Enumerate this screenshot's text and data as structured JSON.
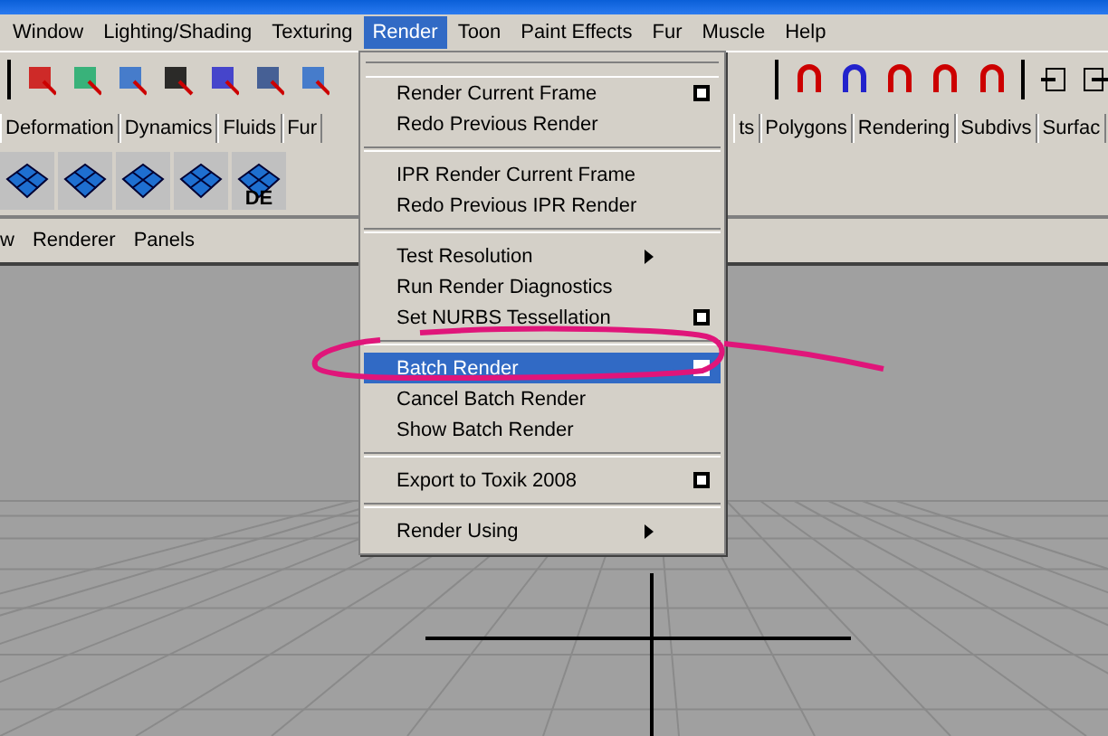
{
  "menubar": [
    {
      "label": "Window",
      "selected": false
    },
    {
      "label": "Lighting/Shading",
      "selected": false
    },
    {
      "label": "Texturing",
      "selected": false
    },
    {
      "label": "Render",
      "selected": true
    },
    {
      "label": "Toon",
      "selected": false
    },
    {
      "label": "Paint Effects",
      "selected": false
    },
    {
      "label": "Fur",
      "selected": false
    },
    {
      "label": "Muscle",
      "selected": false
    },
    {
      "label": "Help",
      "selected": false
    }
  ],
  "shelf_tabs_left": [
    "Deformation",
    "Dynamics",
    "Fluids",
    "Fur"
  ],
  "shelf_tabs_right": [
    "ts",
    "Polygons",
    "Rendering",
    "Subdivs",
    "Surfac"
  ],
  "shelf_icon_label": "DE",
  "panel_menu": [
    "w",
    "Renderer",
    "Panels"
  ],
  "render_menu": [
    {
      "kind": "tearoff"
    },
    {
      "kind": "item",
      "label": "Render Current Frame",
      "option_box": true,
      "submenu": false,
      "selected": false
    },
    {
      "kind": "item",
      "label": "Redo Previous Render",
      "option_box": false,
      "submenu": false,
      "selected": false
    },
    {
      "kind": "separator"
    },
    {
      "kind": "item",
      "label": "IPR Render Current Frame",
      "option_box": false,
      "submenu": false,
      "selected": false
    },
    {
      "kind": "item",
      "label": "Redo Previous IPR Render",
      "option_box": false,
      "submenu": false,
      "selected": false
    },
    {
      "kind": "separator"
    },
    {
      "kind": "item",
      "label": "Test Resolution",
      "option_box": false,
      "submenu": true,
      "selected": false
    },
    {
      "kind": "item",
      "label": "Run Render Diagnostics",
      "option_box": false,
      "submenu": false,
      "selected": false
    },
    {
      "kind": "item",
      "label": "Set NURBS Tessellation",
      "option_box": true,
      "submenu": false,
      "selected": false
    },
    {
      "kind": "separator"
    },
    {
      "kind": "item",
      "label": "Batch Render",
      "option_box": true,
      "submenu": false,
      "selected": true
    },
    {
      "kind": "item",
      "label": "Cancel Batch Render",
      "option_box": false,
      "submenu": false,
      "selected": false
    },
    {
      "kind": "item",
      "label": "Show Batch Render",
      "option_box": false,
      "submenu": false,
      "selected": false
    },
    {
      "kind": "separator"
    },
    {
      "kind": "item",
      "label": "Export to Toxik 2008",
      "option_box": true,
      "submenu": false,
      "selected": false
    },
    {
      "kind": "separator"
    },
    {
      "kind": "item",
      "label": "Render Using",
      "option_box": false,
      "submenu": true,
      "selected": false
    }
  ]
}
